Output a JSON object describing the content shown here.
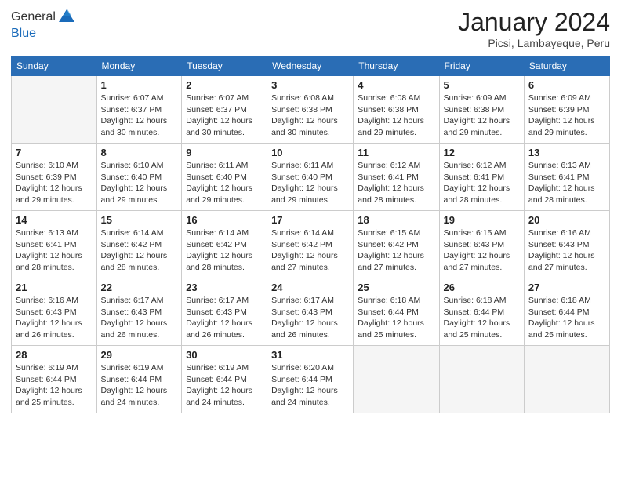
{
  "header": {
    "logo_general": "General",
    "logo_blue": "Blue",
    "month_title": "January 2024",
    "subtitle": "Picsi, Lambayeque, Peru"
  },
  "days_of_week": [
    "Sunday",
    "Monday",
    "Tuesday",
    "Wednesday",
    "Thursday",
    "Friday",
    "Saturday"
  ],
  "weeks": [
    [
      {
        "day": "",
        "sunrise": "",
        "sunset": "",
        "daylight": ""
      },
      {
        "day": "1",
        "sunrise": "Sunrise: 6:07 AM",
        "sunset": "Sunset: 6:37 PM",
        "daylight": "Daylight: 12 hours and 30 minutes."
      },
      {
        "day": "2",
        "sunrise": "Sunrise: 6:07 AM",
        "sunset": "Sunset: 6:37 PM",
        "daylight": "Daylight: 12 hours and 30 minutes."
      },
      {
        "day": "3",
        "sunrise": "Sunrise: 6:08 AM",
        "sunset": "Sunset: 6:38 PM",
        "daylight": "Daylight: 12 hours and 30 minutes."
      },
      {
        "day": "4",
        "sunrise": "Sunrise: 6:08 AM",
        "sunset": "Sunset: 6:38 PM",
        "daylight": "Daylight: 12 hours and 29 minutes."
      },
      {
        "day": "5",
        "sunrise": "Sunrise: 6:09 AM",
        "sunset": "Sunset: 6:38 PM",
        "daylight": "Daylight: 12 hours and 29 minutes."
      },
      {
        "day": "6",
        "sunrise": "Sunrise: 6:09 AM",
        "sunset": "Sunset: 6:39 PM",
        "daylight": "Daylight: 12 hours and 29 minutes."
      }
    ],
    [
      {
        "day": "7",
        "sunrise": "Sunrise: 6:10 AM",
        "sunset": "Sunset: 6:39 PM",
        "daylight": "Daylight: 12 hours and 29 minutes."
      },
      {
        "day": "8",
        "sunrise": "Sunrise: 6:10 AM",
        "sunset": "Sunset: 6:40 PM",
        "daylight": "Daylight: 12 hours and 29 minutes."
      },
      {
        "day": "9",
        "sunrise": "Sunrise: 6:11 AM",
        "sunset": "Sunset: 6:40 PM",
        "daylight": "Daylight: 12 hours and 29 minutes."
      },
      {
        "day": "10",
        "sunrise": "Sunrise: 6:11 AM",
        "sunset": "Sunset: 6:40 PM",
        "daylight": "Daylight: 12 hours and 29 minutes."
      },
      {
        "day": "11",
        "sunrise": "Sunrise: 6:12 AM",
        "sunset": "Sunset: 6:41 PM",
        "daylight": "Daylight: 12 hours and 28 minutes."
      },
      {
        "day": "12",
        "sunrise": "Sunrise: 6:12 AM",
        "sunset": "Sunset: 6:41 PM",
        "daylight": "Daylight: 12 hours and 28 minutes."
      },
      {
        "day": "13",
        "sunrise": "Sunrise: 6:13 AM",
        "sunset": "Sunset: 6:41 PM",
        "daylight": "Daylight: 12 hours and 28 minutes."
      }
    ],
    [
      {
        "day": "14",
        "sunrise": "Sunrise: 6:13 AM",
        "sunset": "Sunset: 6:41 PM",
        "daylight": "Daylight: 12 hours and 28 minutes."
      },
      {
        "day": "15",
        "sunrise": "Sunrise: 6:14 AM",
        "sunset": "Sunset: 6:42 PM",
        "daylight": "Daylight: 12 hours and 28 minutes."
      },
      {
        "day": "16",
        "sunrise": "Sunrise: 6:14 AM",
        "sunset": "Sunset: 6:42 PM",
        "daylight": "Daylight: 12 hours and 28 minutes."
      },
      {
        "day": "17",
        "sunrise": "Sunrise: 6:14 AM",
        "sunset": "Sunset: 6:42 PM",
        "daylight": "Daylight: 12 hours and 27 minutes."
      },
      {
        "day": "18",
        "sunrise": "Sunrise: 6:15 AM",
        "sunset": "Sunset: 6:42 PM",
        "daylight": "Daylight: 12 hours and 27 minutes."
      },
      {
        "day": "19",
        "sunrise": "Sunrise: 6:15 AM",
        "sunset": "Sunset: 6:43 PM",
        "daylight": "Daylight: 12 hours and 27 minutes."
      },
      {
        "day": "20",
        "sunrise": "Sunrise: 6:16 AM",
        "sunset": "Sunset: 6:43 PM",
        "daylight": "Daylight: 12 hours and 27 minutes."
      }
    ],
    [
      {
        "day": "21",
        "sunrise": "Sunrise: 6:16 AM",
        "sunset": "Sunset: 6:43 PM",
        "daylight": "Daylight: 12 hours and 26 minutes."
      },
      {
        "day": "22",
        "sunrise": "Sunrise: 6:17 AM",
        "sunset": "Sunset: 6:43 PM",
        "daylight": "Daylight: 12 hours and 26 minutes."
      },
      {
        "day": "23",
        "sunrise": "Sunrise: 6:17 AM",
        "sunset": "Sunset: 6:43 PM",
        "daylight": "Daylight: 12 hours and 26 minutes."
      },
      {
        "day": "24",
        "sunrise": "Sunrise: 6:17 AM",
        "sunset": "Sunset: 6:43 PM",
        "daylight": "Daylight: 12 hours and 26 minutes."
      },
      {
        "day": "25",
        "sunrise": "Sunrise: 6:18 AM",
        "sunset": "Sunset: 6:44 PM",
        "daylight": "Daylight: 12 hours and 25 minutes."
      },
      {
        "day": "26",
        "sunrise": "Sunrise: 6:18 AM",
        "sunset": "Sunset: 6:44 PM",
        "daylight": "Daylight: 12 hours and 25 minutes."
      },
      {
        "day": "27",
        "sunrise": "Sunrise: 6:18 AM",
        "sunset": "Sunset: 6:44 PM",
        "daylight": "Daylight: 12 hours and 25 minutes."
      }
    ],
    [
      {
        "day": "28",
        "sunrise": "Sunrise: 6:19 AM",
        "sunset": "Sunset: 6:44 PM",
        "daylight": "Daylight: 12 hours and 25 minutes."
      },
      {
        "day": "29",
        "sunrise": "Sunrise: 6:19 AM",
        "sunset": "Sunset: 6:44 PM",
        "daylight": "Daylight: 12 hours and 24 minutes."
      },
      {
        "day": "30",
        "sunrise": "Sunrise: 6:19 AM",
        "sunset": "Sunset: 6:44 PM",
        "daylight": "Daylight: 12 hours and 24 minutes."
      },
      {
        "day": "31",
        "sunrise": "Sunrise: 6:20 AM",
        "sunset": "Sunset: 6:44 PM",
        "daylight": "Daylight: 12 hours and 24 minutes."
      },
      {
        "day": "",
        "sunrise": "",
        "sunset": "",
        "daylight": ""
      },
      {
        "day": "",
        "sunrise": "",
        "sunset": "",
        "daylight": ""
      },
      {
        "day": "",
        "sunrise": "",
        "sunset": "",
        "daylight": ""
      }
    ]
  ]
}
